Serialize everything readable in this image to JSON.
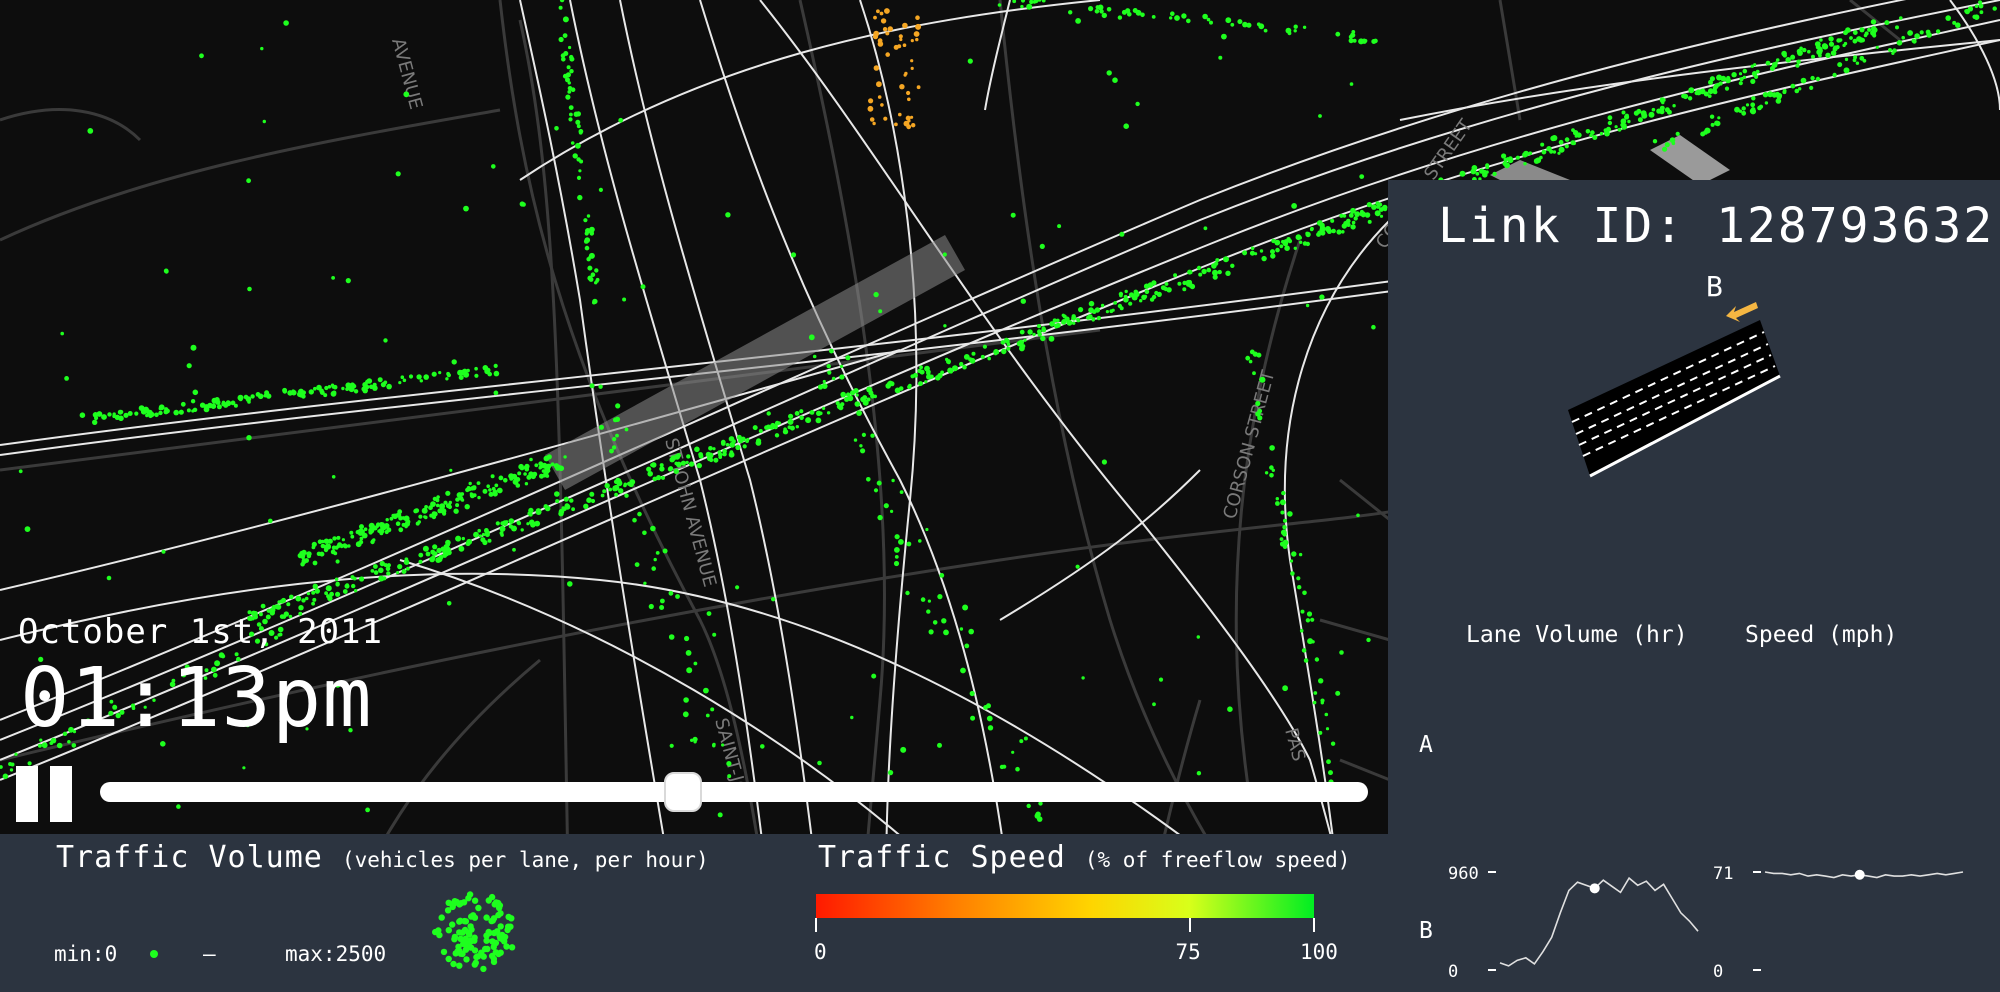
{
  "map": {
    "street_labels": [
      "AVENUE",
      "ST JOHN AVENUE",
      "SAINT-JO",
      "CORSON STREET",
      "PAS",
      "CORSON STREET"
    ]
  },
  "playback": {
    "date": "October 1st, 2011",
    "time": "01:13pm",
    "progress_fraction": 0.46
  },
  "legend": {
    "volume": {
      "title": "Traffic Volume",
      "subtitle": "(vehicles per lane, per hour)",
      "min_label": "min:0",
      "dash": "–",
      "max_label": "max:2500",
      "dot_color": "#1eff1e"
    },
    "speed": {
      "title": "Traffic Speed",
      "subtitle": "(% of freeflow speed)",
      "ticks": [
        "0",
        "75",
        "100"
      ],
      "tick_values": [
        0,
        75,
        100
      ]
    }
  },
  "panel": {
    "link_id": "Link ID: 128793632",
    "direction_label": "B",
    "arrow_color": "#f5b642",
    "volume_header": "Lane Volume (hr)",
    "speed_header": "Speed (mph)",
    "row_a": "A",
    "row_b": "B",
    "volume_max": "960",
    "volume_min": "0",
    "speed_max": "71",
    "speed_min": "0"
  },
  "colors": {
    "panel_bg": "#2c3440",
    "map_bg": "#0d0d0d",
    "vehicle_fast": "#1eff1e",
    "vehicle_slow": "#f5a623"
  },
  "chart_data": [
    {
      "type": "line",
      "title": "Lane Volume (hr)",
      "ylim": [
        0,
        960
      ],
      "x": [
        0,
        1,
        2,
        3,
        4,
        5,
        6,
        7,
        8,
        9,
        10,
        11,
        12,
        13,
        14,
        15,
        16,
        17,
        18,
        19,
        20,
        21,
        22,
        23
      ],
      "series": [
        {
          "values": [
            70,
            40,
            95,
            120,
            60,
            180,
            320,
            560,
            780,
            860,
            830,
            800,
            880,
            820,
            760,
            900,
            830,
            870,
            780,
            840,
            700,
            560,
            480,
            380
          ]
        }
      ],
      "current_index": 11
    },
    {
      "type": "line",
      "title": "Speed (mph)",
      "ylim": [
        0,
        71
      ],
      "x": [
        0,
        1,
        2,
        3,
        4,
        5,
        6,
        7,
        8,
        9,
        10,
        11,
        12,
        13,
        14,
        15,
        16,
        17,
        18,
        19,
        20,
        21,
        22,
        23
      ],
      "series": [
        {
          "values": [
            71,
            70,
            70,
            69,
            70,
            68,
            69,
            68,
            67,
            69,
            68,
            69,
            68,
            67,
            69,
            68,
            68,
            69,
            68,
            69,
            70,
            69,
            70,
            71
          ]
        }
      ],
      "current_index": 11
    }
  ]
}
